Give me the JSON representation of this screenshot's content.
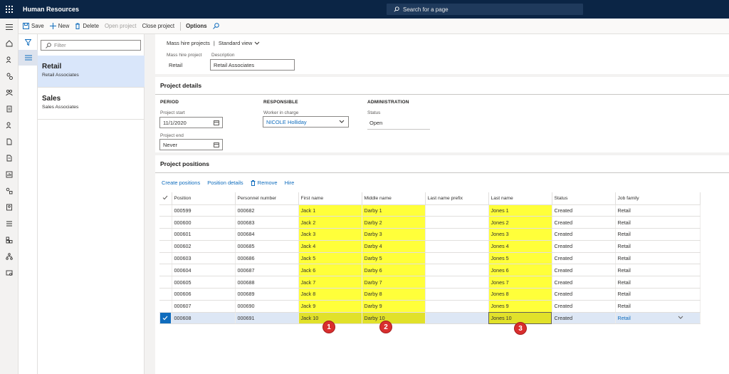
{
  "app": {
    "title": "Human Resources"
  },
  "search": {
    "placeholder": "Search for a page"
  },
  "actions": {
    "save": "Save",
    "new": "New",
    "delete": "Delete",
    "open_project": "Open project",
    "close_project": "Close project",
    "options": "Options"
  },
  "filter": {
    "placeholder": "Filter"
  },
  "list": [
    {
      "title": "Retail",
      "subtitle": "Retail Associates",
      "selected": true
    },
    {
      "title": "Sales",
      "subtitle": "Sales Associates",
      "selected": false
    }
  ],
  "header": {
    "breadcrumb": "Mass hire projects",
    "pipe": "|",
    "view": "Standard view",
    "mass_hire_label": "Mass hire project",
    "mass_hire_value": "Retail",
    "description_label": "Description",
    "description_value": "Retail Associates"
  },
  "project_details": {
    "title": "Project details",
    "period": "PERIOD",
    "project_start_label": "Project start",
    "project_start_value": "11/1/2020",
    "project_end_label": "Project end",
    "project_end_value": "Never",
    "responsible": "RESPONSIBLE",
    "worker_label": "Worker in charge",
    "worker_value": "NICOLE Holliday",
    "administration": "ADMINISTRATION",
    "status_label": "Status",
    "status_value": "Open"
  },
  "positions": {
    "title": "Project positions",
    "tools": {
      "create": "Create positions",
      "details": "Position details",
      "remove": "Remove",
      "hire": "Hire"
    },
    "columns": [
      "Position",
      "Personnel number",
      "First name",
      "Middle name",
      "Last name prefix",
      "Last name",
      "Status",
      "Job family"
    ],
    "rows": [
      [
        "000599",
        "000682",
        "Jack 1",
        "Darby 1",
        "",
        "Jones 1",
        "Created",
        "Retail"
      ],
      [
        "000600",
        "000683",
        "Jack 2",
        "Darby 2",
        "",
        "Jones 2",
        "Created",
        "Retail"
      ],
      [
        "000601",
        "000684",
        "Jack 3",
        "Darby 3",
        "",
        "Jones 3",
        "Created",
        "Retail"
      ],
      [
        "000602",
        "000685",
        "Jack 4",
        "Darby 4",
        "",
        "Jones 4",
        "Created",
        "Retail"
      ],
      [
        "000603",
        "000686",
        "Jack 5",
        "Darby 5",
        "",
        "Jones 5",
        "Created",
        "Retail"
      ],
      [
        "000604",
        "000687",
        "Jack 6",
        "Darby 6",
        "",
        "Jones 6",
        "Created",
        "Retail"
      ],
      [
        "000605",
        "000688",
        "Jack 7",
        "Darby 7",
        "",
        "Jones 7",
        "Created",
        "Retail"
      ],
      [
        "000606",
        "000689",
        "Jack 8",
        "Darby 8",
        "",
        "Jones 8",
        "Created",
        "Retail"
      ],
      [
        "000607",
        "000690",
        "Jack 9",
        "Darby 9",
        "",
        "Jones 9",
        "Created",
        "Retail"
      ],
      [
        "000608",
        "000691",
        "Jack 10",
        "Darby 10",
        "",
        "Jones 10",
        "Created",
        "Retail"
      ]
    ],
    "selected_row": 9
  },
  "callouts": [
    "1",
    "2",
    "3"
  ],
  "colors": {
    "topbar": "#0b2545",
    "accent": "#0f6cbd",
    "highlight": "#ffff3a",
    "callout": "#d92e2e"
  },
  "icons": {
    "rail": [
      "hamburger-icon",
      "home-icon",
      "star-icon",
      "clock-icon",
      "people-icon",
      "document-icon",
      "person-icon",
      "list-icon",
      "chart-icon",
      "grid-icon",
      "org-icon",
      "id-icon",
      "table-icon",
      "module-icon",
      "hierarchy-icon",
      "report-icon"
    ]
  }
}
